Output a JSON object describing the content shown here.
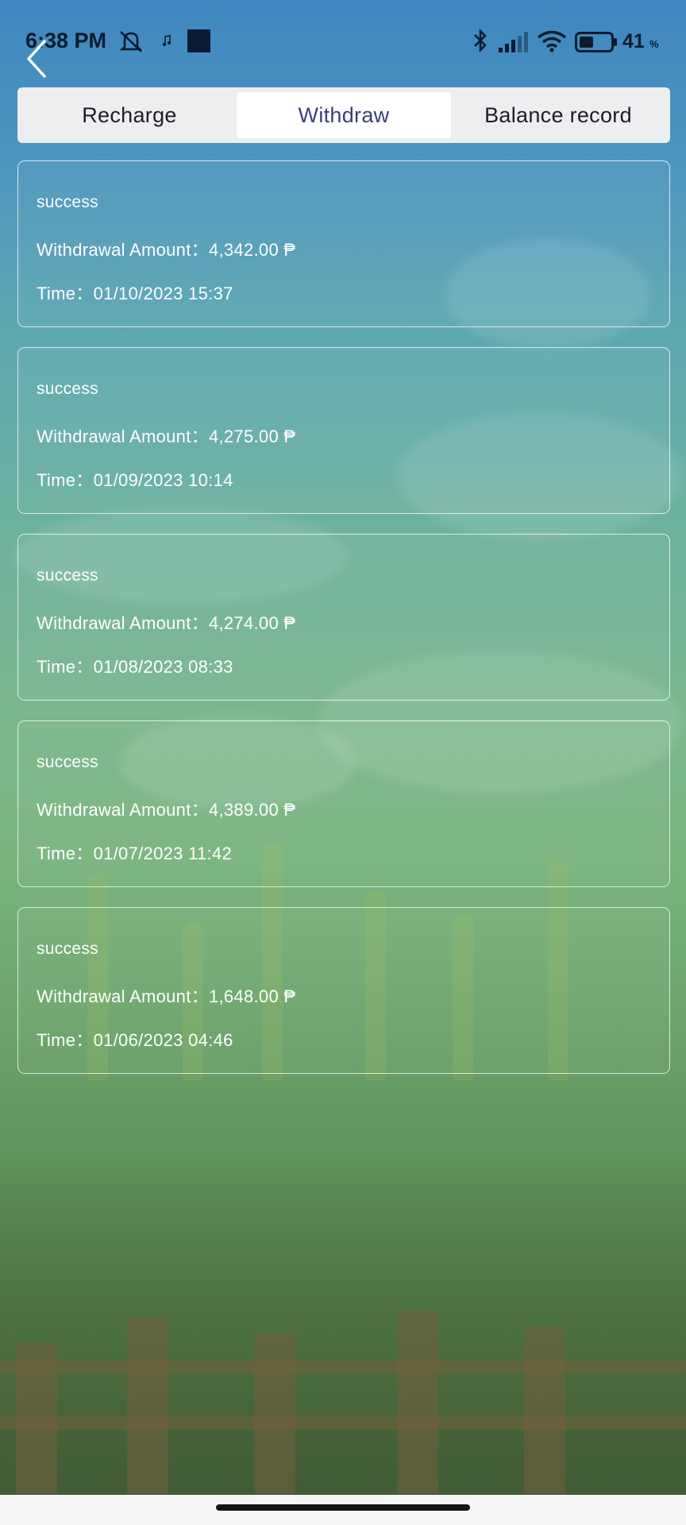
{
  "status_bar": {
    "time": "6:38 PM",
    "battery_percent": "41",
    "battery_unit": "%",
    "icons": [
      "mute-icon",
      "music-note-icon",
      "app-square-icon",
      "bluetooth-icon",
      "signal-icon",
      "wifi-icon",
      "battery-icon"
    ]
  },
  "nav": {
    "back_icon": "chevron-left-icon"
  },
  "tabs": [
    {
      "label": "Recharge",
      "active": false
    },
    {
      "label": "Withdraw",
      "active": true
    },
    {
      "label": "Balance record",
      "active": false
    }
  ],
  "records": [
    {
      "status": "success",
      "amount_label": "Withdrawal Amount：",
      "amount": "4,342.00 ₱",
      "time_label": "Time：",
      "time": "01/10/2023 15:37"
    },
    {
      "status": "success",
      "amount_label": "Withdrawal Amount：",
      "amount": "4,275.00 ₱",
      "time_label": "Time：",
      "time": "01/09/2023 10:14"
    },
    {
      "status": "success",
      "amount_label": "Withdrawal Amount：",
      "amount": "4,274.00 ₱",
      "time_label": "Time：",
      "time": "01/08/2023 08:33"
    },
    {
      "status": "success",
      "amount_label": "Withdrawal Amount：",
      "amount": "4,389.00 ₱",
      "time_label": "Time：",
      "time": "01/07/2023 11:42"
    },
    {
      "status": "success",
      "amount_label": "Withdrawal Amount：",
      "amount": "1,648.00 ₱",
      "time_label": "Time：",
      "time": "01/06/2023 04:46"
    }
  ],
  "colors": {
    "active_tab_text": "#3b3f78",
    "card_border": "#ffffff",
    "sky_top": "#3f86c0",
    "field_green": "#79b47f"
  }
}
